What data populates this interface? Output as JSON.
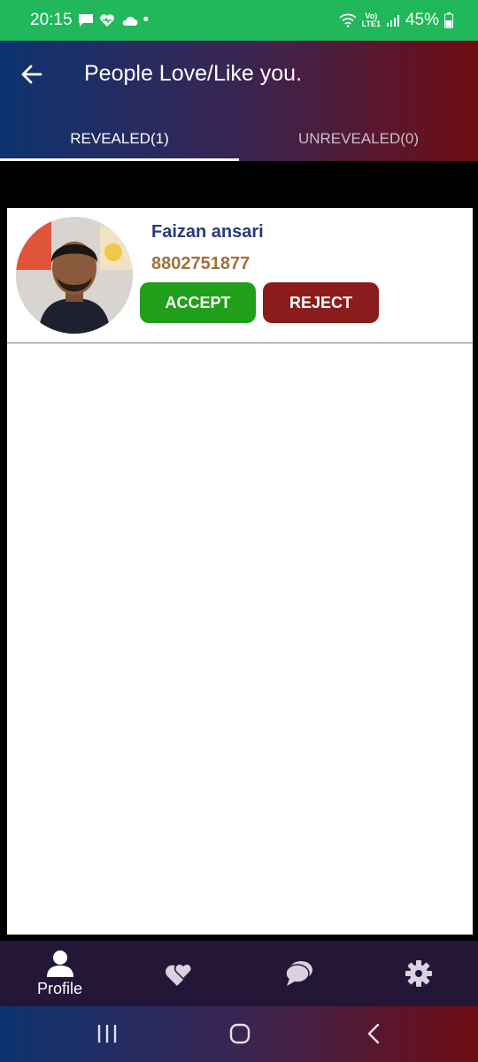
{
  "status_bar": {
    "time": "20:15",
    "dot": "•",
    "lte_top": "Vo)",
    "lte_bottom": "LTE1",
    "battery": "45%",
    "icons": [
      "message-icon",
      "health-heart-icon",
      "cloud-icon",
      "wifi-icon",
      "signal-icon",
      "battery-icon"
    ]
  },
  "header": {
    "title": "People Love/Like you.",
    "back_icon": "arrow-left-icon",
    "gradient": [
      "#0d3370",
      "#3a2553",
      "#6e0d14"
    ]
  },
  "tabs": [
    {
      "label": "REVEALED(1)",
      "active": true
    },
    {
      "label": "UNREVEALED(0)",
      "active": false
    }
  ],
  "people": [
    {
      "name": "Faizan ansari",
      "phone": "8802751877",
      "accept_label": "ACCEPT",
      "reject_label": "REJECT"
    }
  ],
  "bottom_nav": [
    {
      "label": "Profile",
      "icon": "person-icon"
    },
    {
      "icon": "heart-icon"
    },
    {
      "icon": "chat-bubble-icon"
    },
    {
      "icon": "gear-icon"
    }
  ],
  "system_nav": [
    "recents-icon",
    "home-icon",
    "back-icon"
  ],
  "colors": {
    "status_bar": "#20b85a",
    "accept": "#1f9f1a",
    "reject": "#8b1c1c",
    "name": "#2a3a78",
    "phone": "#a26f3c",
    "bottom_nav": "#231637"
  }
}
